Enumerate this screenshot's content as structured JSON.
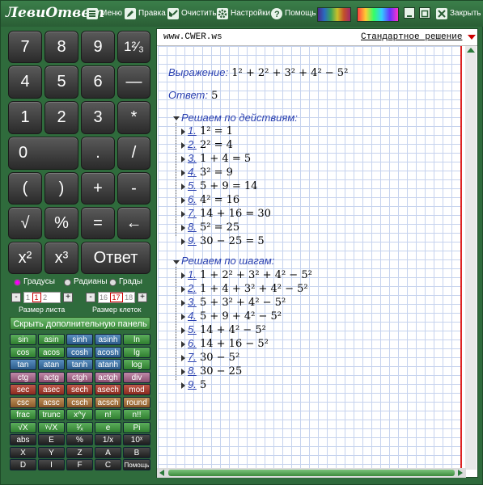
{
  "app": {
    "logo": "ЛевиОтвет"
  },
  "toolbar": {
    "menu": "Меню",
    "edit": "Правка",
    "clear": "Очистить",
    "settings": "Настройки",
    "help": "Помощь",
    "close": "Закрыть"
  },
  "keypad": {
    "k7": "7",
    "k8": "8",
    "k9": "9",
    "kfrac": "1²⁄₃",
    "k4": "4",
    "k5": "5",
    "k6": "6",
    "kminuslong": "—",
    "k1": "1",
    "k2": "2",
    "k3": "3",
    "kmul": "*",
    "k0": "0",
    "kdot": ".",
    "kdiv": "/",
    "klp": "(",
    "krp": ")",
    "kplus": "+",
    "kminus": "-",
    "ksqrt": "√",
    "kpct": "%",
    "keq": "=",
    "kback": "←",
    "kx2": "x²",
    "kx3": "x³",
    "kanswer": "Ответ"
  },
  "modes": {
    "deg": "Градусы",
    "rad": "Радианы",
    "grad": "Грады"
  },
  "sheet": {
    "minus": "-",
    "prev": "1",
    "cur": "1",
    "next": "2",
    "plus": "+",
    "label": "Размер листа"
  },
  "cell": {
    "minus": "-",
    "prev": "16",
    "cur": "17",
    "next": "18",
    "plus": "+",
    "label": "Размер клеток"
  },
  "hide_panel": "Скрыть дополнительную панель",
  "fn": [
    [
      "sin",
      "asin",
      "sinh",
      "asinh",
      "ln"
    ],
    [
      "cos",
      "acos",
      "cosh",
      "acosh",
      "lg"
    ],
    [
      "tan",
      "atan",
      "tanh",
      "atanh",
      "log"
    ],
    [
      "ctg",
      "actg",
      "ctgh",
      "actgh",
      "div"
    ],
    [
      "sec",
      "asec",
      "sech",
      "asech",
      "mod"
    ],
    [
      "csc",
      "acsc",
      "csch",
      "acsch",
      "round"
    ],
    [
      "frac",
      "trunc",
      "x^y",
      "n!",
      "n!!"
    ],
    [
      "√X",
      "ᵞ√X",
      "¹⁄ₓ",
      "e",
      "Pi"
    ],
    [
      "abs",
      "E",
      "%",
      "1/x",
      "10ˣ"
    ],
    [
      "X",
      "Y",
      "Z",
      "A",
      "B"
    ],
    [
      "D",
      "I",
      "F",
      "C",
      "Помощь"
    ]
  ],
  "output": {
    "address": "www.CWER.ws",
    "solution_type": "Стандартное решение",
    "expr_label": "Выражение:",
    "expr": "1² + 2² + 3² + 4² − 5²",
    "answer_label": "Ответ:",
    "answer": "5",
    "actions_title": "Решаем по действиям:",
    "actions": [
      {
        "n": "1.",
        "t": "1² = 1"
      },
      {
        "n": "2.",
        "t": "2² = 4"
      },
      {
        "n": "3.",
        "t": "1 + 4 = 5"
      },
      {
        "n": "4.",
        "t": "3² = 9"
      },
      {
        "n": "5.",
        "t": "5 + 9 = 14"
      },
      {
        "n": "6.",
        "t": "4² = 16"
      },
      {
        "n": "7.",
        "t": "14 + 16 = 30"
      },
      {
        "n": "8.",
        "t": "5² = 25"
      },
      {
        "n": "9.",
        "t": "30 − 25 = 5"
      }
    ],
    "steps_title": "Решаем по шагам:",
    "steps": [
      {
        "n": "1.",
        "t": "1 + 2² + 3² + 4² − 5²"
      },
      {
        "n": "2.",
        "t": "1 + 4 + 3² + 4² − 5²"
      },
      {
        "n": "3.",
        "t": "5 + 3² + 4² − 5²"
      },
      {
        "n": "4.",
        "t": "5 + 9 + 4² − 5²"
      },
      {
        "n": "5.",
        "t": "14 + 4² − 5²"
      },
      {
        "n": "6.",
        "t": "14 + 16 − 5²"
      },
      {
        "n": "7.",
        "t": "30 − 5²"
      },
      {
        "n": "8.",
        "t": "30 − 25"
      },
      {
        "n": "9.",
        "t": "5"
      }
    ]
  }
}
